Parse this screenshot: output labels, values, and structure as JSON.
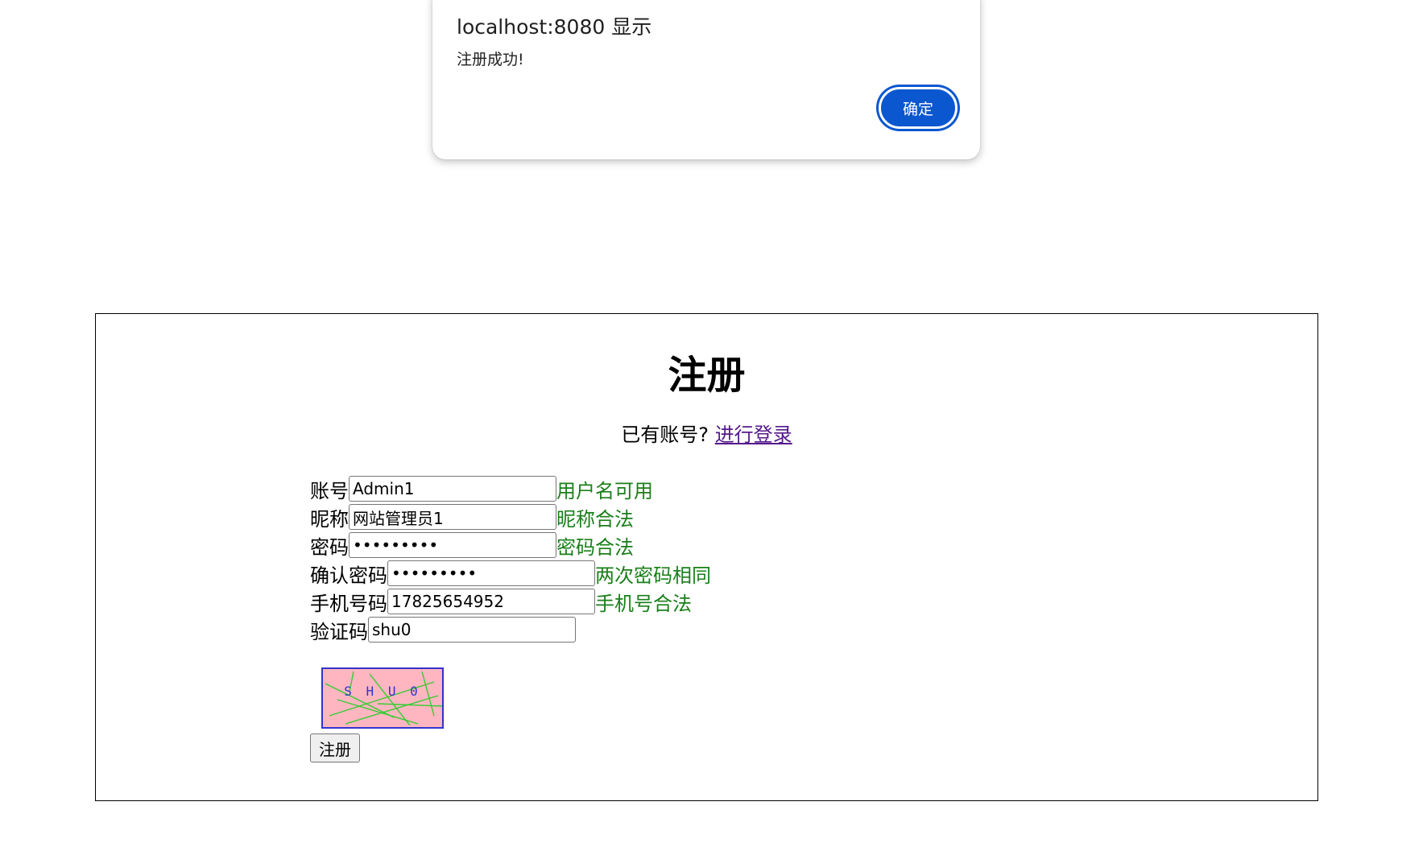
{
  "dialog": {
    "title": "localhost:8080 显示",
    "message": "注册成功!",
    "ok_label": "确定"
  },
  "page": {
    "title": "注册",
    "login_prompt": "已有账号?",
    "login_link": "进行登录"
  },
  "form": {
    "account": {
      "label": "账号",
      "value": "Admin1",
      "hint": "用户名可用"
    },
    "nickname": {
      "label": "昵称",
      "value": "网站管理员1",
      "hint": "昵称合法"
    },
    "password": {
      "label": "密码",
      "value": "•••••••••",
      "hint": "密码合法"
    },
    "confirm_password": {
      "label": "确认密码",
      "value": "•••••••••",
      "hint": "两次密码相同"
    },
    "phone": {
      "label": "手机号码",
      "value": "17825654952",
      "hint": "手机号合法"
    },
    "captcha": {
      "label": "验证码",
      "value": "shu0"
    },
    "captcha_image_text": "S H U 0",
    "submit_label": "注册"
  },
  "colors": {
    "dialog_button": "#0b57d0",
    "hint_text": "#1a7f1a",
    "link_visited": "#551a8b",
    "captcha_background": "#ffb6c1",
    "captcha_border": "#3333cc",
    "captcha_noise": "#33cc33"
  }
}
